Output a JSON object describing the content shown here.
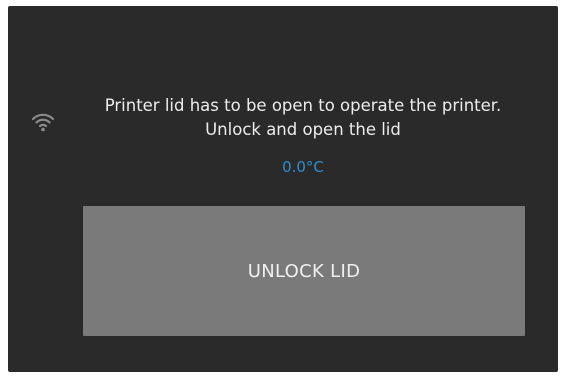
{
  "screen": {
    "message_line1": "Printer lid has to be open to operate the printer.",
    "message_line2": "Unlock and open the lid",
    "temperature": "0.0°C",
    "unlock_button_label": "UNLOCK LID"
  },
  "icons": {
    "status": "wifi-icon"
  },
  "colors": {
    "background": "#2a2a2a",
    "button": "#7a7a7a",
    "accent": "#2f8fce",
    "text": "#ececec"
  }
}
